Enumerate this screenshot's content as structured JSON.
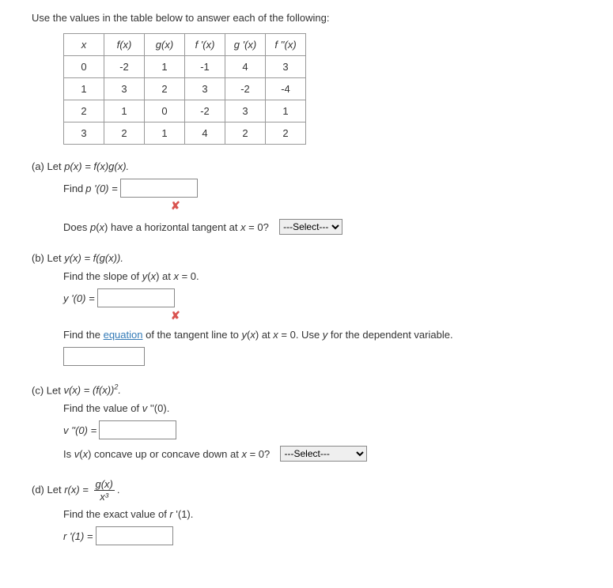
{
  "intro": "Use the values in the table below to answer each of the following:",
  "table": {
    "headers": [
      "x",
      "f(x)",
      "g(x)",
      "f '(x)",
      "g '(x)",
      "f ''(x)"
    ],
    "rows": [
      [
        "0",
        "-2",
        "1",
        "-1",
        "4",
        "3"
      ],
      [
        "1",
        "3",
        "2",
        "3",
        "-2",
        "-4"
      ],
      [
        "2",
        "1",
        "0",
        "-2",
        "3",
        "1"
      ],
      [
        "3",
        "2",
        "1",
        "4",
        "2",
        "2"
      ]
    ]
  },
  "partA": {
    "label": "(a) Let ",
    "def": "p(x) = f(x)g(x).",
    "find": "Find ",
    "lhs": "p '(0) = ",
    "tangentQ": "Does p(x) have a horizontal tangent at x = 0?",
    "select": "---Select---"
  },
  "partB": {
    "label": "(b) Let ",
    "def": "y(x) = f(g(x)).",
    "slope": "Find the slope of y(x) at x = 0.",
    "lhs": "y '(0) = ",
    "tangent1": "Find the ",
    "equation": "equation",
    "tangent2": " of the tangent line to y(x) at x = 0. Use y for the dependent variable."
  },
  "partC": {
    "label": "(c) Let ",
    "def": "v(x) = (f(x))².",
    "find": "Find the value of v ''(0).",
    "lhs": "v ''(0) = ",
    "concaveQ": "Is v(x) concave up or concave down at x = 0?",
    "select": "---Select---"
  },
  "partD": {
    "label": "(d) Let ",
    "def_lhs": "r(x) = ",
    "num": "g(x)",
    "den": "x³",
    "find": "Find the exact value of r '(1).",
    "lhs": "r '(1) = "
  },
  "xmark": "✘"
}
